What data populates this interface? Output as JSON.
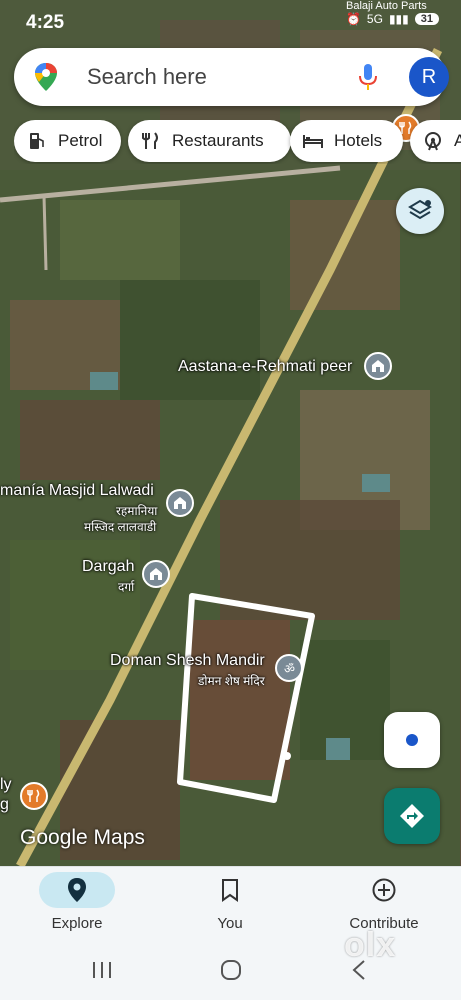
{
  "status_bar": {
    "time": "4:25",
    "battery": "31",
    "signal_label": "5G",
    "top_right_text": "Balaji Auto Parts"
  },
  "search": {
    "placeholder": "Search here",
    "avatar_initial": "R",
    "pin_icon": "google-maps-pin-icon",
    "mic_icon": "microphone-icon"
  },
  "chips": [
    {
      "label": "Petrol",
      "icon": "gas-station-icon"
    },
    {
      "label": "Restaurants",
      "icon": "fork-knife-icon"
    },
    {
      "label": "Hotels",
      "icon": "bed-icon"
    },
    {
      "label": "At",
      "icon": "ferris-wheel-icon"
    }
  ],
  "map_labels": {
    "aastana": "Aastana-e-Rehmati peer",
    "masjid": "manía Masjid Lalwadi",
    "masjid_hindi_1": "रहमानिया",
    "masjid_hindi_2": "मस्जिद लालवाडी",
    "dargah": "Dargah",
    "dargah_hindi": "दर्गा",
    "mandir": "Doman Shesh Mandir",
    "mandir_hindi": "डोमन शेष मंदिर",
    "left_edge_1": "ly",
    "left_edge_2": "g"
  },
  "logo": "Google Maps",
  "bottom_nav": [
    {
      "label": "Explore",
      "icon": "location-pin-icon",
      "active": true
    },
    {
      "label": "You",
      "icon": "bookmark-icon",
      "active": false
    },
    {
      "label": "Contribute",
      "icon": "add-circle-icon",
      "active": false
    }
  ],
  "watermark": "olx",
  "colors": {
    "accent_blue": "#1a56c9",
    "active_nav": "#c9e8f2",
    "directions_teal": "#0b7c6f",
    "road": "#c9b870"
  }
}
